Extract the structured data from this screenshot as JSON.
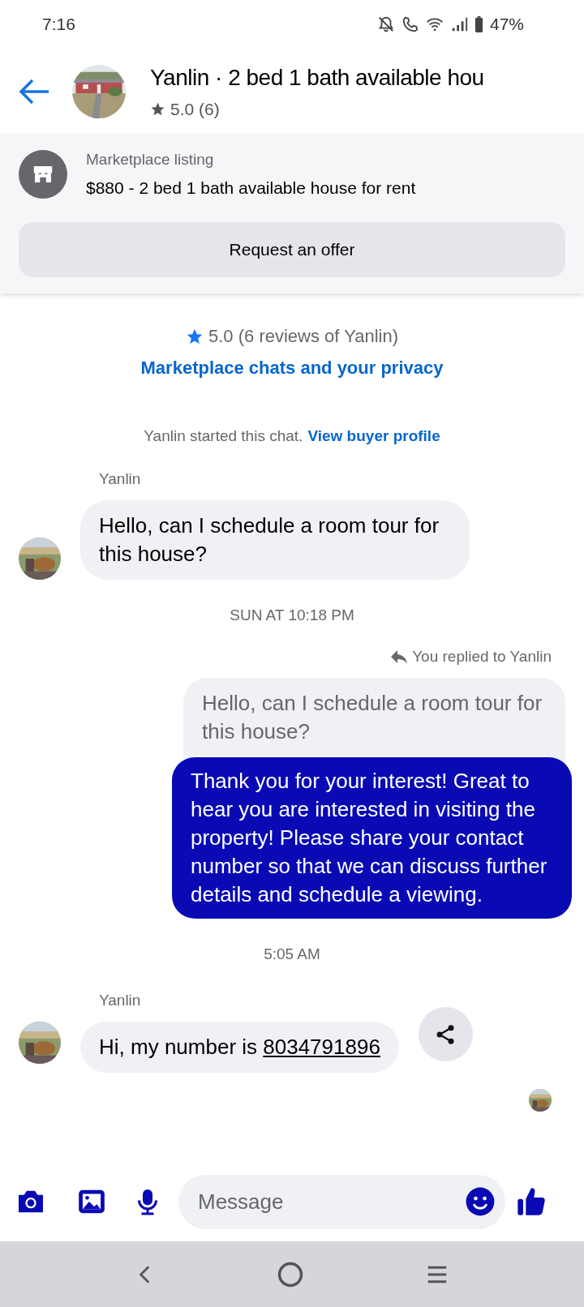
{
  "status_bar": {
    "time": "7:16",
    "battery": "47%"
  },
  "header": {
    "title": "Yanlin · 2 bed 1 bath available hou",
    "rating": "5.0 (6)"
  },
  "listing": {
    "label": "Marketplace listing",
    "title": "$880 - 2 bed 1 bath available house for rent",
    "button": "Request an offer"
  },
  "intro": {
    "rating": "5.0 (6 reviews of Yanlin)",
    "privacy_link": "Marketplace chats and your privacy",
    "started": "Yanlin started this chat.",
    "profile_link": "View buyer profile"
  },
  "messages": [
    {
      "kind": "incoming",
      "sender": "Yanlin",
      "text": "Hello, can I schedule a room tour for this house?"
    },
    {
      "kind": "timestamp",
      "text": "SUN AT 10:18 PM"
    },
    {
      "kind": "reply",
      "note": "You replied to Yanlin",
      "quote": "Hello, can I schedule a room tour for this house?",
      "text": "Thank you for your interest! Great to hear you are interested in visiting the property! Please share your contact number so that we can discuss further details and schedule a viewing."
    },
    {
      "kind": "timestamp",
      "text": "5:05 AM"
    },
    {
      "kind": "incoming",
      "sender": "Yanlin",
      "text": "Hi, my number is",
      "link": "8034791896",
      "share": true
    }
  ],
  "composer": {
    "placeholder": "Message"
  }
}
